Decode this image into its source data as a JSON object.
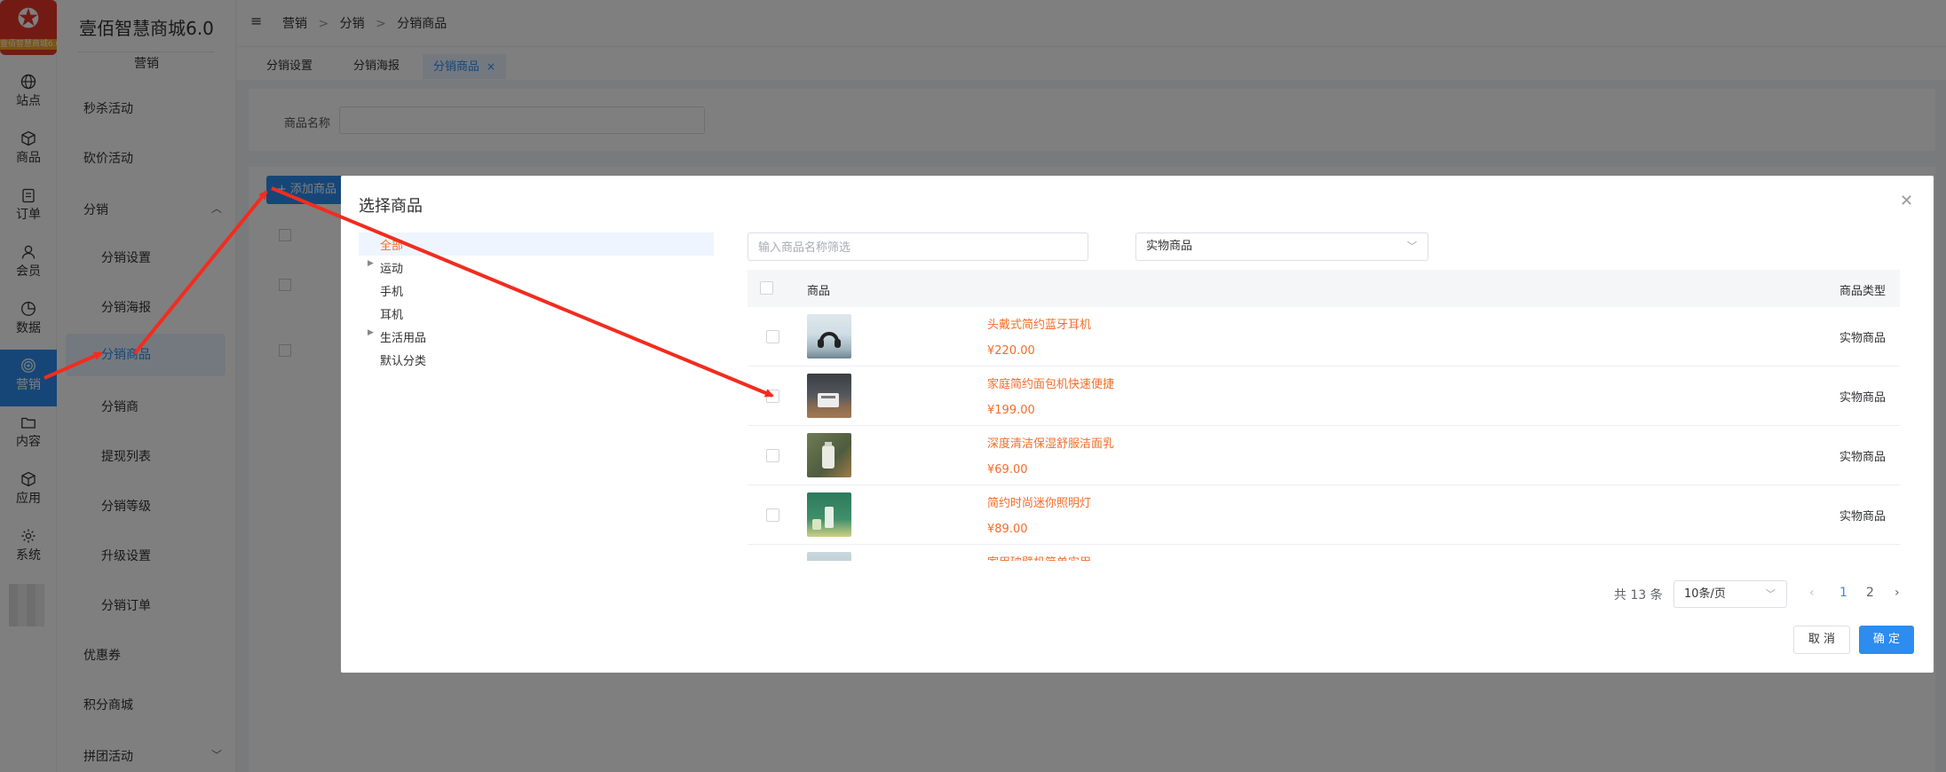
{
  "rail": {
    "logo_version": "壹佰智慧商城6.0",
    "items": [
      {
        "label": "站点",
        "icon": "globe-icon"
      },
      {
        "label": "商品",
        "icon": "cube-icon"
      },
      {
        "label": "订单",
        "icon": "clipboard-icon"
      },
      {
        "label": "会员",
        "icon": "user-icon"
      },
      {
        "label": "数据",
        "icon": "pie-chart-icon"
      },
      {
        "label": "营销",
        "icon": "target-icon"
      },
      {
        "label": "内容",
        "icon": "folder-icon"
      },
      {
        "label": "应用",
        "icon": "box-icon"
      },
      {
        "label": "系统",
        "icon": "gear-icon"
      }
    ],
    "active": "营销"
  },
  "menu": {
    "brand": "壹佰智慧商城6.0",
    "section": "营销",
    "items": {
      "seckill": "秒杀活动",
      "bargain": "砍价活动",
      "distribution": "分销",
      "dist_settings": "分销设置",
      "dist_poster": "分销海报",
      "dist_goods": "分销商品",
      "distributor": "分销商",
      "withdraw": "提现列表",
      "dist_level": "分销等级",
      "upgrade": "升级设置",
      "dist_orders": "分销订单",
      "coupon": "优惠券",
      "points_mall": "积分商城",
      "group_buy": "拼团活动"
    }
  },
  "breadcrumb": {
    "c1": "营销",
    "c2": "分销",
    "c3": "分销商品",
    "sep": ">"
  },
  "tabs": {
    "t1": "分销设置",
    "t2": "分销海报",
    "t3": "分销商品"
  },
  "filter": {
    "label": "商品名称"
  },
  "add_button": "+ 添加商品",
  "dialog": {
    "title": "选择商品",
    "tree": [
      "全部",
      "运动",
      "手机",
      "耳机",
      "生活用品",
      "默认分类"
    ],
    "search_placeholder": "输入商品名称筛选",
    "type_select": "实物商品",
    "col_goods": "商品",
    "col_type": "商品类型",
    "rows": [
      {
        "name": "头戴式简约蓝牙耳机",
        "price": "¥220.00",
        "type": "实物商品"
      },
      {
        "name": "家庭简约面包机快速便捷",
        "price": "¥199.00",
        "type": "实物商品"
      },
      {
        "name": "深度清洁保湿舒服洁面乳",
        "price": "¥69.00",
        "type": "实物商品"
      },
      {
        "name": "简约时尚迷你照明灯",
        "price": "¥89.00",
        "type": "实物商品"
      },
      {
        "name": "家用破壁机简单实用",
        "price": "",
        "type": ""
      }
    ],
    "pagination": {
      "total": "共 13 条",
      "page_size": "10条/页",
      "pages": [
        "1",
        "2"
      ],
      "current": "1",
      "prev": "‹",
      "next": "›"
    },
    "cancel": "取 消",
    "confirm": "确 定"
  },
  "colors": {
    "accent": "#2d8cf0",
    "price": "#f56c2a",
    "annotation_arrow": "#f22c1e"
  }
}
